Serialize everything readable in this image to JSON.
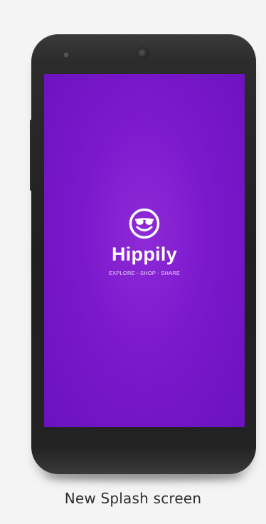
{
  "splash": {
    "logo_icon": "smiley-sunglasses-icon",
    "app_name": "Hippily",
    "tagline": "EXPLORE - SHOP - SHARE",
    "background_color": "#7b18cc"
  },
  "caption": "New Splash screen"
}
